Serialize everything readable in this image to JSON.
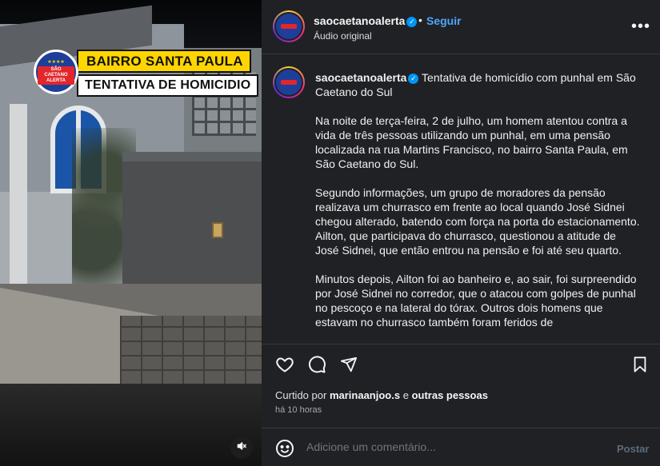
{
  "media": {
    "badge_text": "SÃO CAETANO ALERTA",
    "headline_top": "BAIRRO SANTA PAULA",
    "headline_bottom": "TENTATIVA DE HOMICIDIO",
    "mute_icon": "speaker-muted-icon"
  },
  "header": {
    "username": "saocaetanoalerta",
    "separator": "•",
    "follow_label": "Seguir",
    "audio_label": "Áudio original",
    "more_icon": "more-options-icon"
  },
  "caption": {
    "username": "saocaetanoalerta",
    "title": "Tentativa de homicídio com punhal em São Caetano do Sul",
    "paragraphs": [
      "Na noite de terça-feira, 2 de julho, um homem atentou contra a vida de três pessoas utilizando um punhal, em uma pensão localizada na rua Martins Francisco, no bairro Santa Paula, em São Caetano do Sul.",
      "Segundo informações, um grupo de moradores da pensão realizava um churrasco em frente ao local quando José Sidnei chegou alterado, batendo com força na porta do estacionamento. Ailton, que participava do churrasco, questionou a atitude de José Sidnei, que então entrou na pensão e foi até seu quarto.",
      "Minutos depois, Ailton foi ao banheiro e, ao sair, foi surpreendido por José Sidnei no corredor, que o atacou com golpes de punhal no pescoço e na lateral do tórax. Outros dois homens que estavam no churrasco também foram feridos de"
    ]
  },
  "actions": {
    "like_icon": "heart-icon",
    "comment_icon": "comment-icon",
    "share_icon": "share-icon",
    "save_icon": "bookmark-icon"
  },
  "likes": {
    "prefix": "Curtido por",
    "user": "marinaanjoo.s",
    "connector": "e",
    "others": "outras pessoas"
  },
  "timestamp": "há 10 horas",
  "comment": {
    "placeholder": "Adicione um comentário...",
    "post_label": "Postar",
    "emoji_icon": "emoji-icon"
  },
  "colors": {
    "accent": "#0095f6",
    "follow": "#4ca7f8",
    "panel_bg": "#202124",
    "headline_yellow": "#ffd500"
  }
}
